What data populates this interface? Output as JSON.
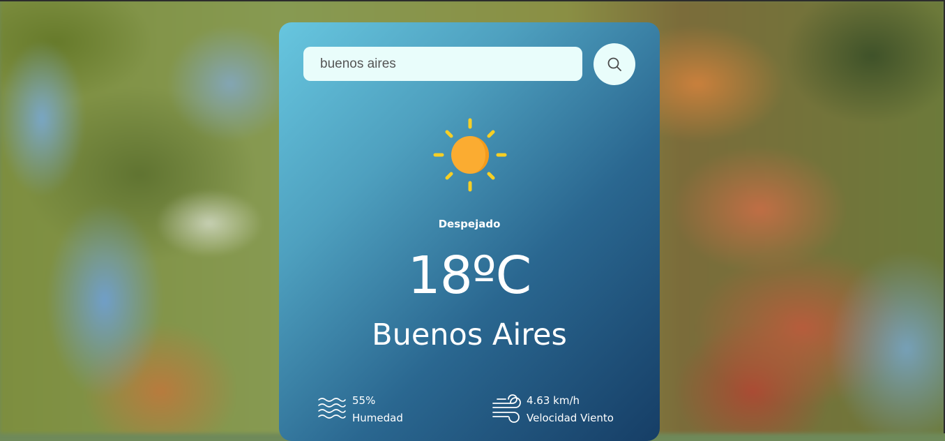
{
  "search": {
    "value": "buenos aires"
  },
  "weather": {
    "condition": "Despejado",
    "temperature": "18ºC",
    "city": "Buenos Aires",
    "humidity_value": "55%",
    "humidity_label": "Humedad",
    "wind_value": "4.63 km/h",
    "wind_label": "Velocidad Viento"
  },
  "icons": {
    "search": "search-icon",
    "weather": "sun-icon",
    "humidity": "humidity-icon",
    "wind": "wind-icon"
  },
  "colors": {
    "sun_core": "#fbac31",
    "sun_rays": "#f7cf24",
    "input_bg": "#e9fdfb",
    "card_gradient_start": "#67c6df",
    "card_gradient_end": "#163e66"
  }
}
